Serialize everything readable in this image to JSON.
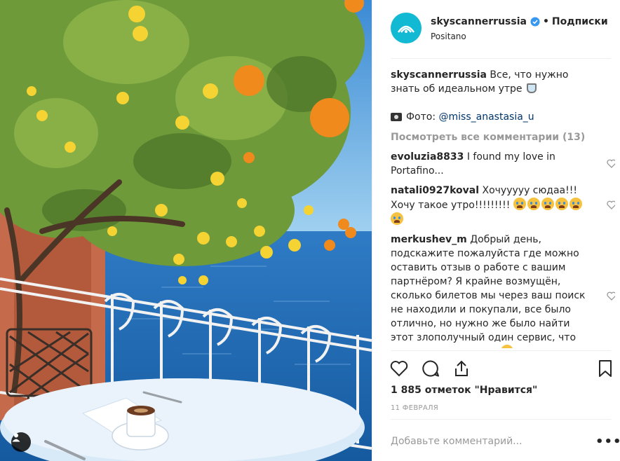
{
  "post": {
    "username": "skyscannerrussia",
    "verified": true,
    "follow_separator": "•",
    "follow_label": "Подписки",
    "location": "Positano",
    "caption_text": "Все, что нужно знать об идеальном утре",
    "photo_credit_label": "Фото:",
    "photo_credit_user": "@miss_anastasia_u",
    "view_all_label": "Посмотреть все комментарии (13)"
  },
  "comments": [
    {
      "username": "evoluzia8833",
      "text": "I found my love in Portafino..."
    },
    {
      "username": "natali0927koval",
      "text": "Хочууууу сюдаа!!! Хочу такое утро!!!!!!!!!",
      "emoji_count": 6
    },
    {
      "username": "merkushev_m",
      "text": "Добрый день, подскажите пожалуйста где можно оставить отзыв о работе с вашим партнёром? Я крайне возмущён, сколько билетов мы через ваш поиск не находили и покупали, все было отлично, но нужно же было найти этот злополучный один сервис, что истрепал все нервы."
    }
  ],
  "stats": {
    "likes": "1 885 отметок \"Нравится\"",
    "date": "11 ФЕВРАЛЯ"
  },
  "add_comment": {
    "placeholder": "Добавьте комментарий..."
  },
  "more_label": "•••",
  "colors": {
    "brand": "#11b9d3",
    "verified": "#3897f0",
    "link": "#003569",
    "muted": "#999999",
    "text": "#262626",
    "sea": "#1f65ad",
    "orange": "#f08a1c",
    "lemon": "#f4d332"
  },
  "icons": [
    "user-tag-icon",
    "skyscanner-logo-icon",
    "verified-badge-icon",
    "heart-icon",
    "comment-icon",
    "share-icon",
    "bookmark-icon",
    "camera-emoji-icon"
  ]
}
